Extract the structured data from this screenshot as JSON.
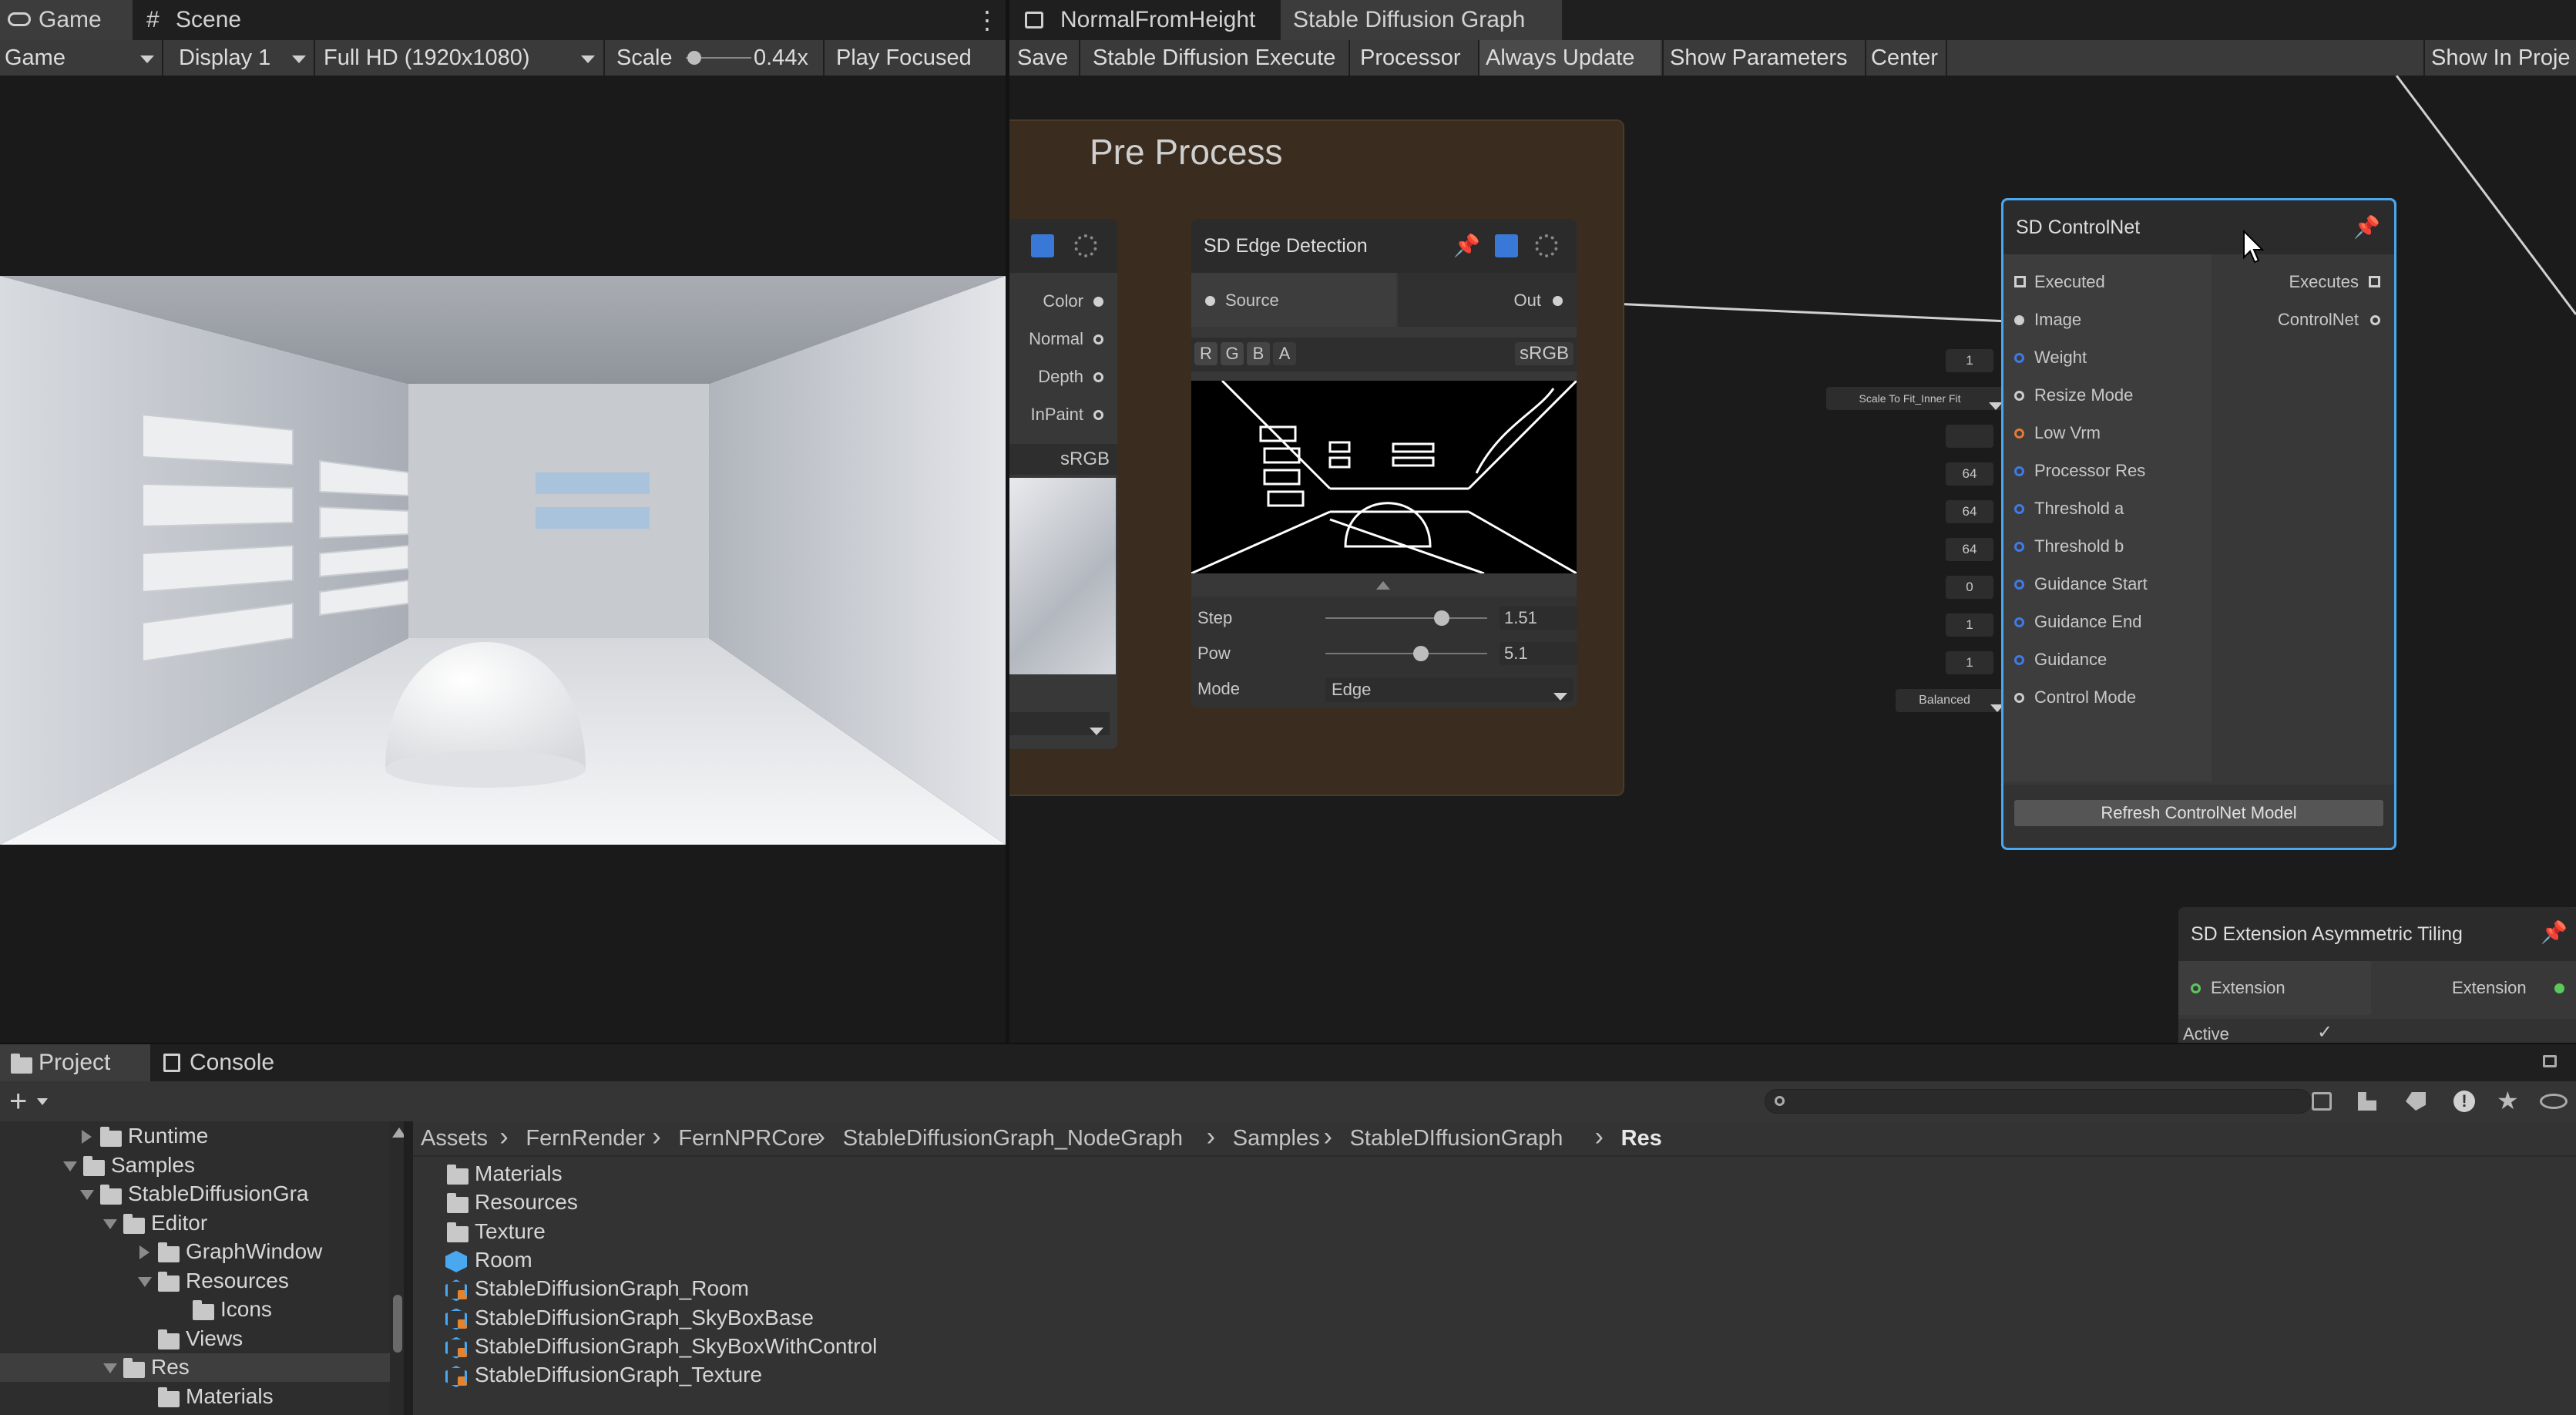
{
  "left_tabs": {
    "game": "Game",
    "scene": "Scene"
  },
  "game_toolbar": {
    "mode": "Game",
    "display": "Display 1",
    "resolution": "Full HD (1920x1080)",
    "scale_label": "Scale",
    "scale_value": "0.44x",
    "play_focused": "Play Focused"
  },
  "right_tabs": {
    "normal_from_height": "NormalFromHeight",
    "sd_graph": "Stable Diffusion Graph"
  },
  "graph_toolbar": {
    "save": "Save",
    "execute": "Stable Diffusion Execute",
    "processor": "Processor",
    "always_update": "Always Update",
    "show_parameters": "Show Parameters",
    "center": "Center",
    "show_in_project": "Show In Proje"
  },
  "pre_process": {
    "title": "Pre Process"
  },
  "left_node": {
    "ports": [
      "Color",
      "Normal",
      "Depth",
      "InPaint"
    ],
    "srgb": "sRGB"
  },
  "edge_node": {
    "title": "SD Edge Detection",
    "source": "Source",
    "out": "Out",
    "channels": [
      "R",
      "G",
      "B",
      "A"
    ],
    "srgb": "sRGB",
    "step_label": "Step",
    "step_value": "1.51",
    "step_fraction": 0.74,
    "pow_label": "Pow",
    "pow_value": "5.1",
    "pow_fraction": 0.6,
    "mode_label": "Mode",
    "mode_value": "Edge"
  },
  "controlnet": {
    "title": "SD ControlNet",
    "inputs": [
      "Executed",
      "Image",
      "Weight",
      "Resize Mode",
      "Low Vrm",
      "Processor Res",
      "Threshold a",
      "Threshold b",
      "Guidance Start",
      "Guidance End",
      "Guidance",
      "Control Mode"
    ],
    "outputs": [
      "Executes",
      "ControlNet"
    ],
    "refresh": "Refresh ControlNet Model",
    "input_colors": [
      "#cccccc",
      "#cccccc",
      "#3f7be6",
      "#cccccc",
      "#e0793a",
      "#3f7be6",
      "#3f7be6",
      "#3f7be6",
      "#3f7be6",
      "#3f7be6",
      "#3f7be6",
      "#cccccc"
    ]
  },
  "controlnet_fields": {
    "weight": "1",
    "resize_mode": "Scale To Fit_Inner Fit",
    "processor_res": "64",
    "threshold_a": "64",
    "threshold_b": "64",
    "guidance_start": "0",
    "guidance_end": "1",
    "guidance": "1",
    "control_mode": "Balanced"
  },
  "asym_node": {
    "title": "SD Extension Asymmetric Tiling",
    "in": "Extension",
    "out": "Extension",
    "active": "Active",
    "active_check": "✓"
  },
  "bottom_tabs": {
    "project": "Project",
    "console": "Console"
  },
  "project_toolbar": {
    "add": "+"
  },
  "tree": [
    {
      "label": "Runtime",
      "arrow": "right"
    },
    {
      "label": "Samples",
      "arrow": "down"
    },
    {
      "label": "StableDiffusionGra",
      "arrow": "down"
    },
    {
      "label": "Editor",
      "arrow": "down"
    },
    {
      "label": "GraphWindow",
      "arrow": "right"
    },
    {
      "label": "Resources",
      "arrow": "down"
    },
    {
      "label": "Icons",
      "arrow": ""
    },
    {
      "label": "Views",
      "arrow": ""
    },
    {
      "label": "Res",
      "arrow": "down"
    },
    {
      "label": "Materials",
      "arrow": ""
    }
  ],
  "breadcrumb": [
    "Assets",
    "FernRender",
    "FernNPRCore",
    "StableDiffusionGraph_NodeGraph",
    "Samples",
    "StableDIffusionGraph",
    "Res"
  ],
  "files": [
    {
      "name": "Materials",
      "icon": "folder"
    },
    {
      "name": "Resources",
      "icon": "folder"
    },
    {
      "name": "Texture",
      "icon": "folder"
    },
    {
      "name": "Room",
      "icon": "prefab"
    },
    {
      "name": "StableDiffusionGraph_Room",
      "icon": "graph"
    },
    {
      "name": "StableDiffusionGraph_SkyBoxBase",
      "icon": "graph"
    },
    {
      "name": "StableDiffusionGraph_SkyBoxWithControl",
      "icon": "graph"
    },
    {
      "name": "StableDiffusionGraph_Texture",
      "icon": "graph"
    }
  ],
  "colors": {
    "accent": "#4aa8f0",
    "pin": "#e6832a",
    "green_port": "#5ac85a"
  }
}
